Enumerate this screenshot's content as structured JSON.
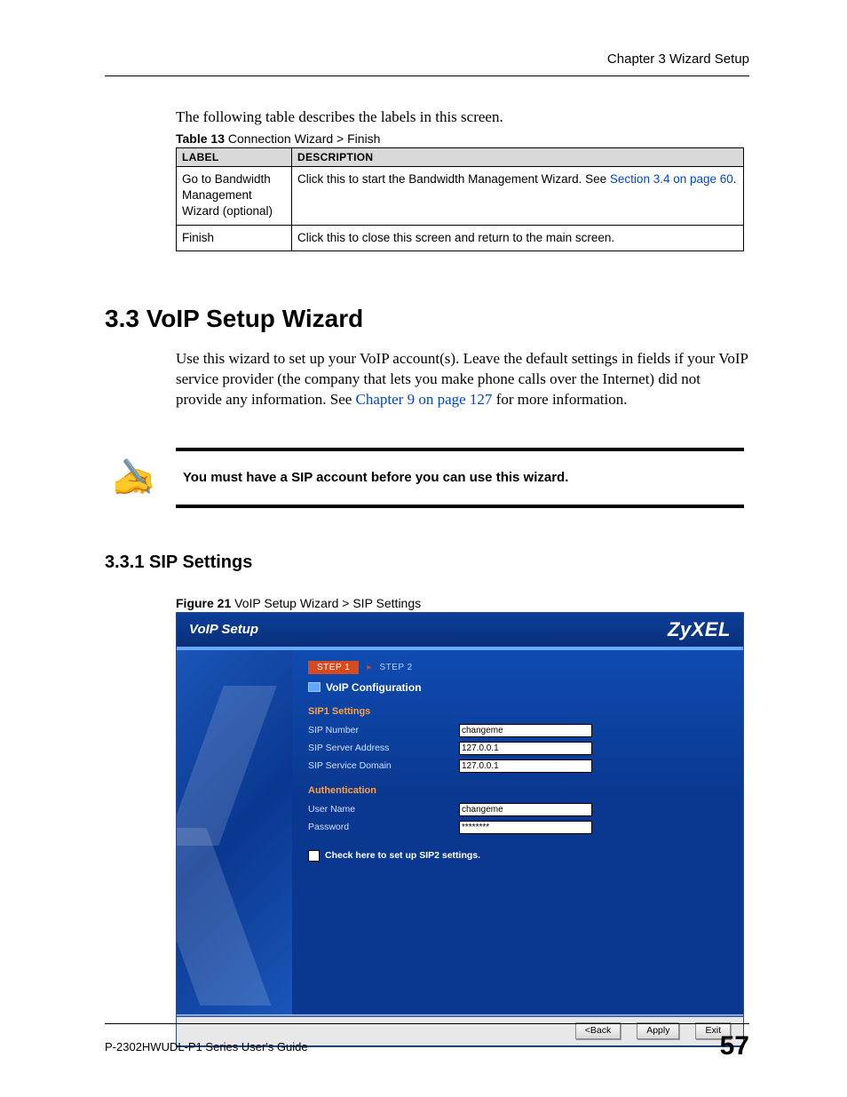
{
  "header": {
    "chapter": "Chapter 3 Wizard Setup"
  },
  "intro": "The following table describes the labels in this screen.",
  "table_caption": {
    "bold": "Table 13",
    "rest": "   Connection Wizard > Finish"
  },
  "table": {
    "headers": [
      "LABEL",
      "DESCRIPTION"
    ],
    "rows": [
      {
        "label": "Go to Bandwidth Management Wizard (optional)",
        "desc_pre": "Click this to start the Bandwidth Management Wizard. See ",
        "desc_link": "Section 3.4 on page 60",
        "desc_post": "."
      },
      {
        "label": "Finish",
        "desc": "Click this to close this screen and return to the main screen."
      }
    ]
  },
  "h2": "3.3  VoIP Setup Wizard",
  "para2_pre": "Use this wizard to set up your VoIP account(s). Leave the default settings in fields if your VoIP service provider (the company that lets you make phone calls over the Internet) did not provide any information. See ",
  "para2_link": "Chapter 9 on page 127",
  "para2_post": " for more information.",
  "note": "You must have a SIP account before you can use this wizard.",
  "h3": "3.3.1  SIP Settings",
  "fig_caption": {
    "bold": "Figure 21",
    "rest": "   VoIP Setup Wizard > SIP Settings"
  },
  "shot": {
    "title": "VoIP Setup",
    "brand": "ZyXEL",
    "step1": "STEP 1",
    "step2": "STEP 2",
    "conf_title": "VoIP Configuration",
    "sec1": "SIP1   Settings",
    "fields1": [
      {
        "label": "SIP Number",
        "value": "changeme"
      },
      {
        "label": "SIP Server Address",
        "value": "127.0.0.1"
      },
      {
        "label": "SIP Service Domain",
        "value": "127.0.0.1"
      }
    ],
    "sec2": "Authentication",
    "fields2": [
      {
        "label": "User Name",
        "value": "changeme"
      },
      {
        "label": "Password",
        "value": "********"
      }
    ],
    "sip2_label": "Check here to set up SIP2 settings.",
    "buttons": {
      "back": "<Back",
      "apply": "Apply",
      "exit": "Exit"
    }
  },
  "footer": {
    "left": "P-2302HWUDL-P1 Series User's Guide",
    "right": "57"
  },
  "chart_data": {
    "type": "table",
    "title": "Table 13 Connection Wizard > Finish",
    "columns": [
      "LABEL",
      "DESCRIPTION"
    ],
    "rows": [
      [
        "Go to Bandwidth Management Wizard (optional)",
        "Click this to start the Bandwidth Management Wizard. See Section 3.4 on page 60."
      ],
      [
        "Finish",
        "Click this to close this screen and return to the main screen."
      ]
    ]
  }
}
